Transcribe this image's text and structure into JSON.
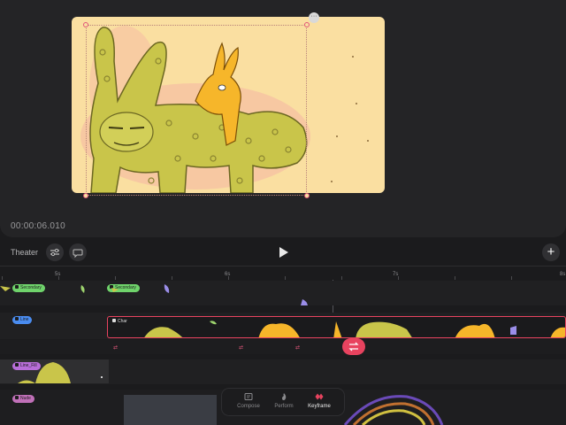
{
  "preview": {
    "timecode": "00:00:06.010",
    "more_label": "···"
  },
  "toolbar": {
    "theater_label": "Theater",
    "add_label": "+"
  },
  "ruler": {
    "labels": [
      "5s",
      "6s",
      "7s",
      "8s"
    ]
  },
  "tracks": {
    "secondary_label": "Secondary",
    "secondary_label_2": "Secondary",
    "line_label": "Line",
    "char_label": "Char",
    "line_fill_label": "Line_Fill",
    "nude_label": "Nude"
  },
  "modes": [
    {
      "label": "Compose",
      "icon": "compose-icon"
    },
    {
      "label": "Perform",
      "icon": "perform-icon"
    },
    {
      "label": "Keyframe",
      "icon": "keyframe-icon"
    }
  ],
  "colors": {
    "accent": "#e8435f",
    "canvas": "#fadfa1",
    "secondary_tag": "#6fd36b",
    "line_tag": "#4a8cf0",
    "line_fill_tag": "#b86ed8",
    "nude_tag": "#c070b8",
    "creature": "#c9c54a"
  }
}
